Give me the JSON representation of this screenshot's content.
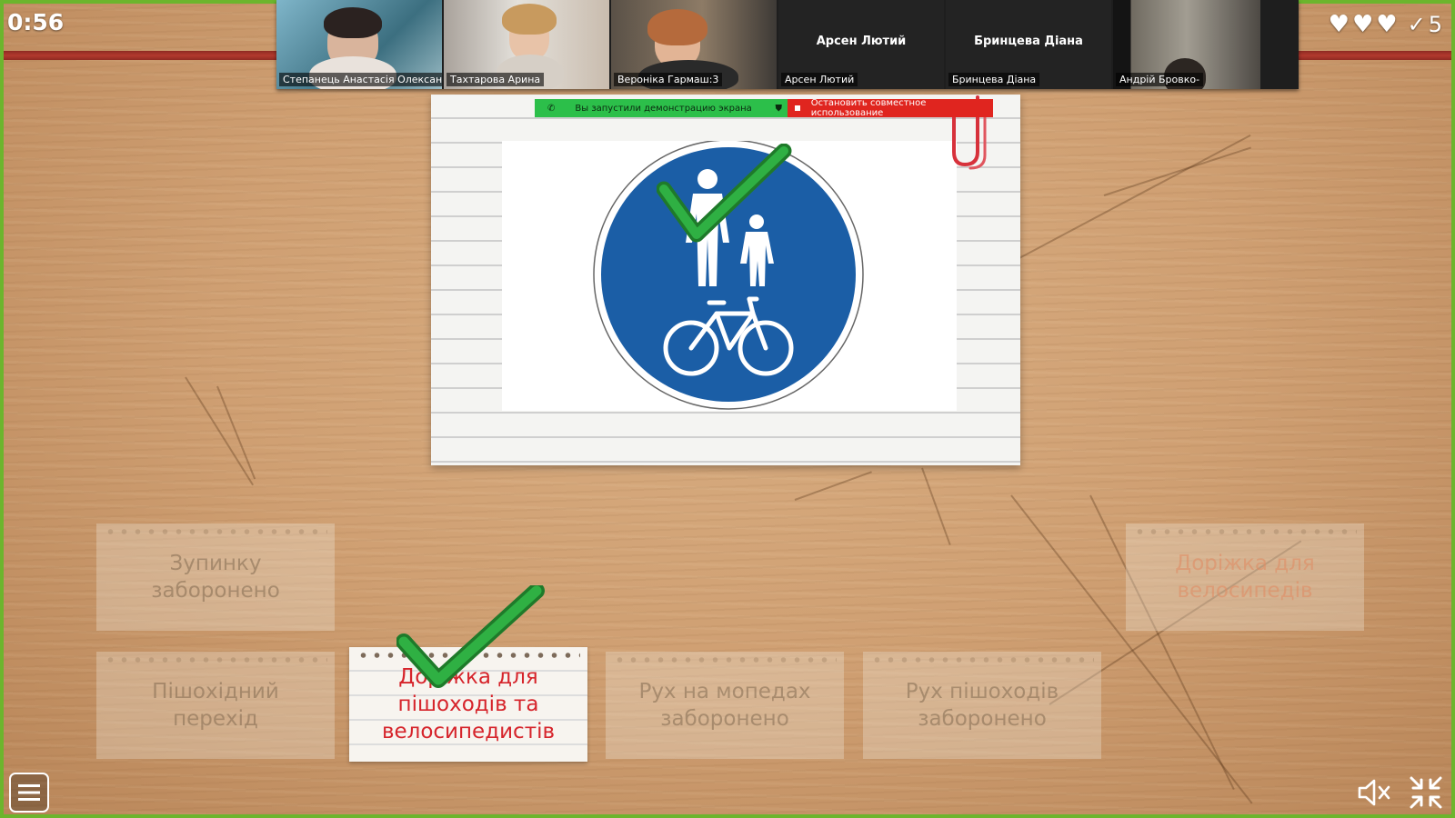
{
  "game": {
    "timer": "0:56",
    "score": "5",
    "hearts": 3
  },
  "video_strip": {
    "participants": [
      {
        "name": "Степанець Анастасія Олександрівна",
        "has_video": true,
        "speaking": false
      },
      {
        "name": "Тахтарова Арина",
        "has_video": true,
        "speaking": true
      },
      {
        "name": "Вероніка Гармаш:3",
        "has_video": true,
        "speaking": false
      },
      {
        "name": "Арсен Лютий",
        "display_name": "Арсен Лютий",
        "has_video": false,
        "speaking": false
      },
      {
        "name": "Бринцева Діана",
        "display_name": "Бринцева Діана",
        "has_video": false,
        "speaking": false
      },
      {
        "name": "Андрій Бровко-",
        "has_video": true,
        "speaking": false
      }
    ]
  },
  "share_banner": {
    "status": "Вы запустили демонстрацию экрана",
    "stop_label": "Остановить совместное использование"
  },
  "question": {
    "image": "shared-pedestrian-bicycle-path-sign",
    "sign_color": "#1b5ea6"
  },
  "answers": [
    {
      "label": "Зупинку заборонено",
      "state": "faded"
    },
    {
      "label": "Доріжка для велосипедів",
      "state": "faded"
    },
    {
      "label": "Пішохідний перехід",
      "state": "faded"
    },
    {
      "label": "Доріжка для пішоходів та велосипедистів",
      "state": "correct"
    },
    {
      "label": "Рух на мопедах заборонено",
      "state": "faded"
    },
    {
      "label": "Рух пішоходів заборонено",
      "state": "faded"
    }
  ],
  "controls": {
    "menu_icon": "menu-icon",
    "mute_icon": "speaker-muted-icon",
    "fullscreen_icon": "exit-fullscreen-icon"
  },
  "colors": {
    "frame": "#6cb52d",
    "top_bar": "#b2392e",
    "correct_text": "#d6242b",
    "check": "#27a23a"
  }
}
